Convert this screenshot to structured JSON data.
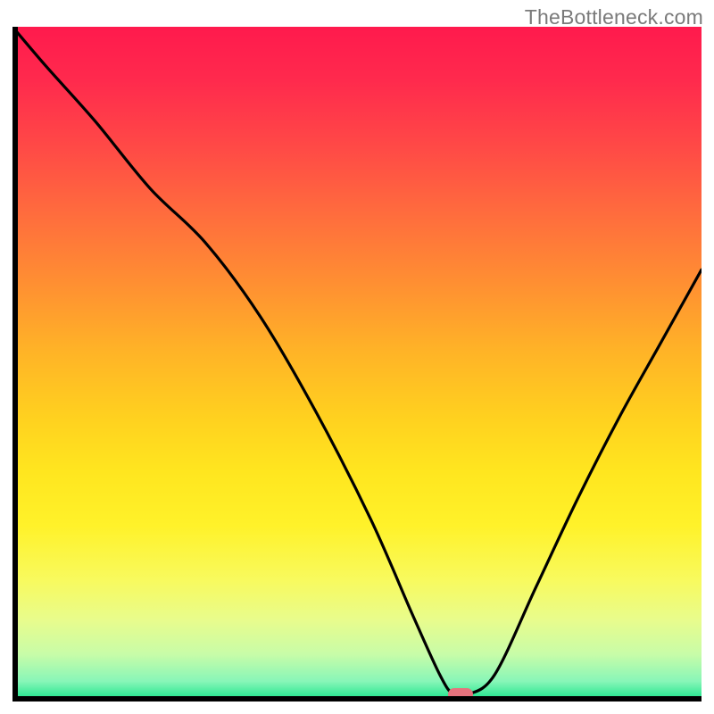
{
  "watermark": "TheBottleneck.com",
  "chart_data": {
    "type": "line",
    "title": "",
    "xlabel": "",
    "ylabel": "",
    "xlim": [
      0,
      100
    ],
    "ylim": [
      0,
      100
    ],
    "grid": false,
    "legend": false,
    "background": {
      "type": "vertical-gradient",
      "stops": [
        {
          "pct": 0,
          "color": "#ff1a4d"
        },
        {
          "pct": 18,
          "color": "#ff4a46"
        },
        {
          "pct": 38,
          "color": "#ff8f32"
        },
        {
          "pct": 58,
          "color": "#ffd11f"
        },
        {
          "pct": 74,
          "color": "#fff22a"
        },
        {
          "pct": 88,
          "color": "#e8fc8d"
        },
        {
          "pct": 97,
          "color": "#88f6b8"
        },
        {
          "pct": 100,
          "color": "#12e387"
        }
      ],
      "meaning": "red = high bottleneck, green = low bottleneck"
    },
    "series": [
      {
        "name": "bottleneck-curve",
        "color": "#000000",
        "x": [
          0,
          5,
          12,
          20,
          28,
          36,
          44,
          52,
          58,
          62,
          64,
          66,
          70,
          76,
          82,
          88,
          94,
          100
        ],
        "y": [
          100,
          94,
          86,
          76,
          68,
          57,
          43,
          27,
          13,
          4,
          1,
          1,
          4,
          17,
          30,
          42,
          53,
          64
        ]
      }
    ],
    "marker": {
      "name": "optimal-point",
      "x": 65,
      "y": 1,
      "color": "#e5737d",
      "shape": "pill"
    }
  }
}
